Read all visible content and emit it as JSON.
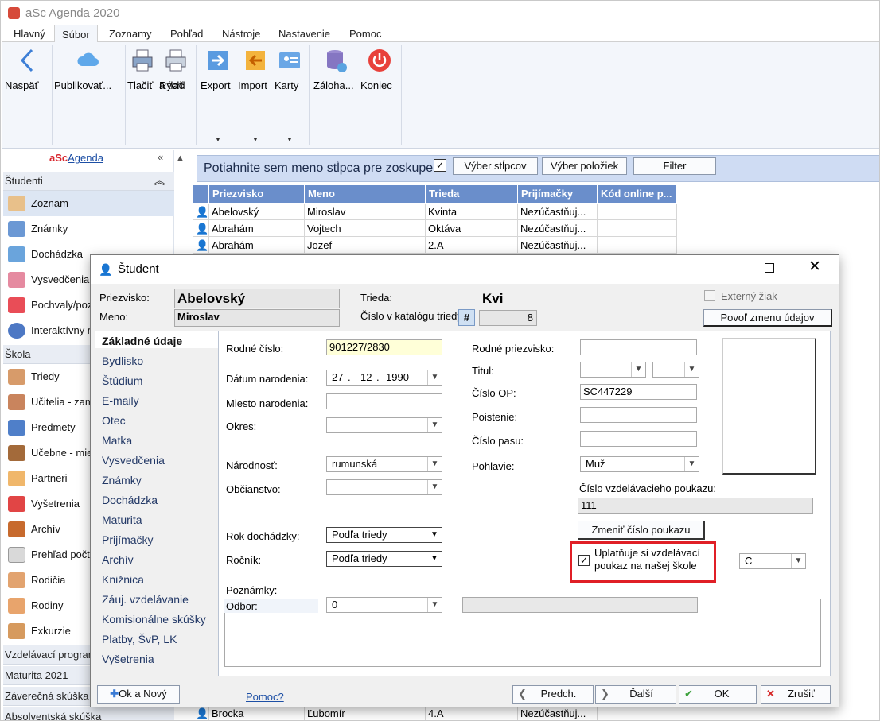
{
  "app": {
    "title": "aSc Agenda 2020"
  },
  "tabs": [
    "Hlavný",
    "Súbor",
    "Zoznamy",
    "Pohľad",
    "Nástroje",
    "Nastavenie",
    "Pomoc"
  ],
  "ribbon": {
    "back": "Naspäť",
    "publish": "Publikovať...",
    "print": "Tlačiť",
    "quick_print_1": "Rýchl",
    "quick_print_2": "a tlač",
    "export": "Export",
    "import": "Import",
    "cards": "Karty",
    "backup": "Záloha...",
    "exit": "Koniec"
  },
  "sidebar": {
    "brand_red": "aSc",
    "brand_blue": "Agenda",
    "section_students": "Študenti",
    "section_school": "Škola",
    "students": [
      "Zoznam",
      "Známky",
      "Dochádzka",
      "Vysvedčenia",
      "Pochvaly/poz",
      "Interaktívny r"
    ],
    "school": [
      "Triedy",
      "Učitelia - zam",
      "Predmety",
      "Učebne - mie",
      "Partneri",
      "Vyšetrenia",
      "Archív",
      "Prehľad počt",
      "Rodičia",
      "Rodiny",
      "Exkurzie"
    ],
    "footer": [
      "Vzdelávací program",
      "Maturita 2021",
      "Záverečná skúška",
      "Absolventská skúška"
    ]
  },
  "grid": {
    "group_hint": "Potiahnite sem meno stĺpca pre zoskupenie",
    "btn_columns": "Výber stĺpcov",
    "btn_items": "Výber položiek",
    "btn_filter": "Filter",
    "headers": [
      "Priezvisko",
      "Meno",
      "Trieda",
      "Prijímačky",
      "Kód online p..."
    ],
    "rows": [
      [
        "Abelovský",
        "Miroslav",
        "Kvinta",
        "Nezúčastňuj..."
      ],
      [
        "Abrahám",
        "Vojtech",
        "Oktáva",
        "Nezúčastňuj..."
      ],
      [
        "Abrahám",
        "Jozef",
        "2.A",
        "Nezúčastňuj..."
      ]
    ],
    "last_row": [
      "Brocka",
      "Ľubomír",
      "4.A",
      "Nezúčastňuj..."
    ]
  },
  "dialog": {
    "title": "Študent",
    "surname_label": "Priezvisko:",
    "surname": "Abelovský",
    "name_label": "Meno:",
    "name": "Miroslav",
    "class_label": "Trieda:",
    "class": "Kvi",
    "catalog_label": "Číslo v katalógu triedy",
    "catalog": "8",
    "hash": "#",
    "external": "Externý žiak",
    "allow_btn": "Povoľ zmenu údajov",
    "nav": [
      "Základné údaje",
      "Bydlisko",
      "Štúdium",
      "E-maily",
      "Otec",
      "Matka",
      "Vysvedčenia",
      "Známky",
      "Dochádzka",
      "Maturita",
      "Prijímačky",
      "Archív",
      "Knižnica",
      "Záuj. vzdelávanie",
      "Komisionálne skúšky",
      "Platby, ŠvP, LK",
      "Vyšetrenia"
    ],
    "birth_no_label": "Rodné číslo:",
    "birth_no": "901227/2830",
    "dob_label": "Dátum narodenia:",
    "dob_d": "27",
    "dob_m": "12",
    "dob_y": "1990",
    "birthplace_label": "Miesto narodenia:",
    "district_label": "Okres:",
    "nationality_label": "Národnosť:",
    "nationality": "rumunská",
    "citizenship_label": "Občianstvo:",
    "attendance_label": "Rok dochádzky:",
    "attendance": "Podľa triedy",
    "year_label": "Ročník:",
    "year": "Podľa triedy",
    "notes_label": "Poznámky:",
    "branch_label": "Odbor:",
    "branch": "0",
    "maiden_label": "Rodné priezvisko:",
    "title_label": "Titul:",
    "id_label": "Číslo OP:",
    "id_no": "SC447229",
    "insurance_label": "Poistenie:",
    "passport_label": "Číslo pasu:",
    "gender_label": "Pohlavie:",
    "gender": "Muž",
    "voucher_label": "Číslo vzdelávacieho poukazu:",
    "voucher": "111",
    "change_voucher": "Zmeniť číslo poukazu",
    "uses_voucher_1": "Uplatňuje si vzdelávací",
    "uses_voucher_2": "poukaz na našej škole",
    "voucher_type": "C",
    "ok_new": "Ok a Nový",
    "help": "Pomoc?",
    "prev": "Predch.",
    "next": "Ďalší",
    "ok": "OK",
    "cancel": "Zrušiť"
  },
  "colors": {
    "accent": "#6a8ecb",
    "highlight": "#e01f26",
    "birth_no_bg": "#ffffd8"
  }
}
